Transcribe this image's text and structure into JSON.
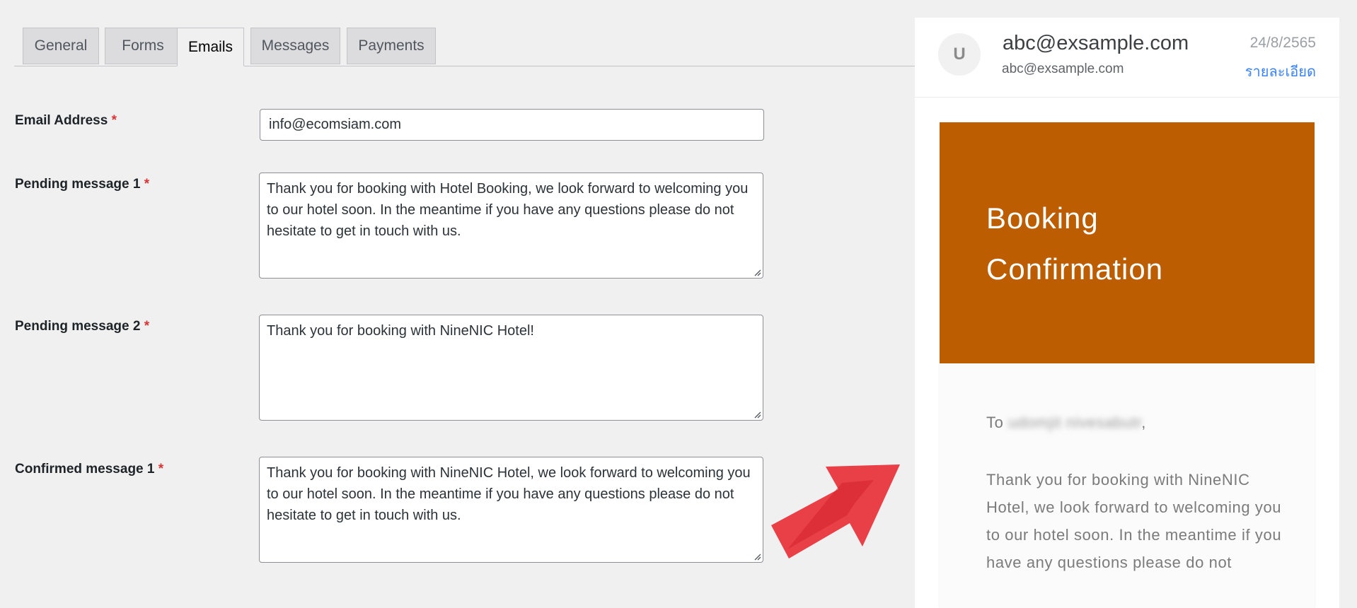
{
  "tabs": [
    {
      "label": "General",
      "active": false
    },
    {
      "label": "Forms",
      "active": false
    },
    {
      "label": "Emails",
      "active": true
    },
    {
      "label": "Messages",
      "active": false
    },
    {
      "label": "Payments",
      "active": false
    }
  ],
  "form": {
    "required_mark": "*",
    "email_label": "Email Address",
    "email_value": "info@ecomsiam.com",
    "pending1_label": "Pending message 1",
    "pending1_value": "Thank you for booking with Hotel Booking, we look forward to welcoming you to our hotel soon. In the meantime if you have any questions please do not hesitate to get in touch with us.",
    "pending2_label": "Pending message 2",
    "pending2_value": "Thank you for booking with NineNIC Hotel!",
    "confirmed1_label": "Confirmed message 1",
    "confirmed1_value": "Thank you for booking with NineNIC Hotel, we look forward to welcoming you to our hotel soon. In the meantime if you have any questions please do not hesitate to get in touch with us."
  },
  "preview": {
    "avatar_letter": "U",
    "sender_name": "abc@exsample.com",
    "sender_email": "abc@exsample.com",
    "date": "24/8/2565",
    "details_link": "รายละเอียด",
    "banner_title": "Booking Confirmation",
    "greeting_prefix": "To",
    "recipient_name": "udomjit nivesabutr",
    "greeting_suffix": ",",
    "body_text": "Thank you for booking with NineNIC Hotel, we look forward to welcoming you to our hotel soon. In the meantime if you have any questions please do not",
    "banner_color": "#bb5d00"
  },
  "colors": {
    "arrow": "#e8313a",
    "required": "#d63638",
    "link": "#3b82f6"
  }
}
